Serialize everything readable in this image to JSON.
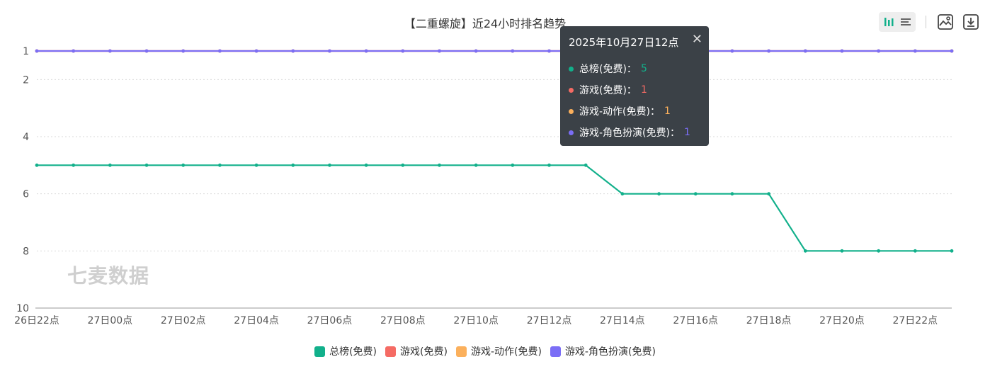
{
  "toolbar": {
    "icons": [
      "bar-chart-icon",
      "list-icon",
      "image-download-icon",
      "download-icon"
    ]
  },
  "watermark": "七麦数据",
  "tooltip": {
    "title": "2025年10月27日12点",
    "rows": [
      {
        "name": "总榜(免费)",
        "value": "5",
        "color": "#12b08b"
      },
      {
        "name": "游戏(免费)",
        "value": "1",
        "color": "#f56b64"
      },
      {
        "name": "游戏-动作(免费)",
        "value": "1",
        "color": "#fbb05c"
      },
      {
        "name": "游戏-角色扮演(免费)",
        "value": "1",
        "color": "#7b6ef6"
      }
    ]
  },
  "chart_data": {
    "type": "line",
    "title": "【二重螺旋】近24小时排名趋势",
    "xlabel": "",
    "ylabel": "",
    "y_inverted": true,
    "ylim": [
      1,
      10
    ],
    "y_ticks": [
      1,
      2,
      4,
      6,
      8,
      10
    ],
    "grid": true,
    "legend_position": "bottom",
    "x": [
      "26日22点",
      "26日23点",
      "27日00点",
      "27日01点",
      "27日02点",
      "27日03点",
      "27日04点",
      "27日05点",
      "27日06点",
      "27日07点",
      "27日08点",
      "27日09点",
      "27日10点",
      "27日11点",
      "27日12点",
      "27日13点",
      "27日14点",
      "27日15点",
      "27日16点",
      "27日17点",
      "27日18点",
      "27日19点",
      "27日20点",
      "27日21点",
      "27日22点",
      "27日23点"
    ],
    "x_tick_labels": [
      "26日22点",
      "27日00点",
      "27日02点",
      "27日04点",
      "27日06点",
      "27日08点",
      "27日10点",
      "27日12点",
      "27日14点",
      "27日16点",
      "27日18点",
      "27日20点",
      "27日22点"
    ],
    "series": [
      {
        "name": "总榜(免费)",
        "color": "#12b08b",
        "values": [
          5,
          5,
          5,
          5,
          5,
          5,
          5,
          5,
          5,
          5,
          5,
          5,
          5,
          5,
          5,
          5,
          6,
          6,
          6,
          6,
          6,
          8,
          8,
          8,
          8,
          8
        ]
      },
      {
        "name": "游戏(免费)",
        "color": "#f56b64",
        "values": [
          1,
          1,
          1,
          1,
          1,
          1,
          1,
          1,
          1,
          1,
          1,
          1,
          1,
          1,
          1,
          1,
          1,
          1,
          1,
          1,
          1,
          1,
          1,
          1,
          1,
          1
        ]
      },
      {
        "name": "游戏-动作(免费)",
        "color": "#fbb05c",
        "values": [
          1,
          1,
          1,
          1,
          1,
          1,
          1,
          1,
          1,
          1,
          1,
          1,
          1,
          1,
          1,
          1,
          1,
          1,
          1,
          1,
          1,
          1,
          1,
          1,
          1,
          1
        ]
      },
      {
        "name": "游戏-角色扮演(免费)",
        "color": "#7b6ef6",
        "values": [
          1,
          1,
          1,
          1,
          1,
          1,
          1,
          1,
          1,
          1,
          1,
          1,
          1,
          1,
          1,
          1,
          1,
          1,
          1,
          1,
          1,
          1,
          1,
          1,
          1,
          1
        ]
      }
    ]
  }
}
